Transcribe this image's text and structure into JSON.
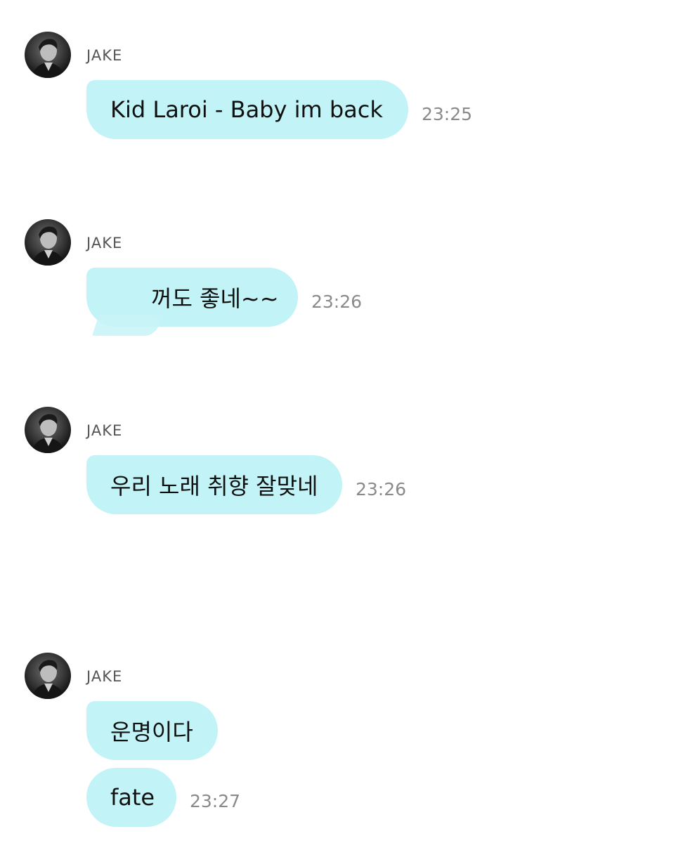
{
  "colors": {
    "bubble": "#c2f3f7",
    "sender_text": "#555555",
    "time_text": "#8a8a8a",
    "background": "#ffffff"
  },
  "messages": [
    {
      "sender": "JAKE",
      "bubbles": [
        {
          "text": "Kid Laroi - Baby im back"
        }
      ],
      "time": "23:25"
    },
    {
      "sender": "JAKE",
      "bubbles": [
        {
          "text": "꺼도 좋네~~"
        }
      ],
      "time": "23:26"
    },
    {
      "sender": "JAKE",
      "bubbles": [
        {
          "text": "우리 노래 취향 잘맞네"
        }
      ],
      "time": "23:26"
    },
    {
      "sender": "JAKE",
      "bubbles": [
        {
          "text": "운명이다"
        },
        {
          "text": "fate"
        }
      ],
      "time": "23:27"
    }
  ]
}
